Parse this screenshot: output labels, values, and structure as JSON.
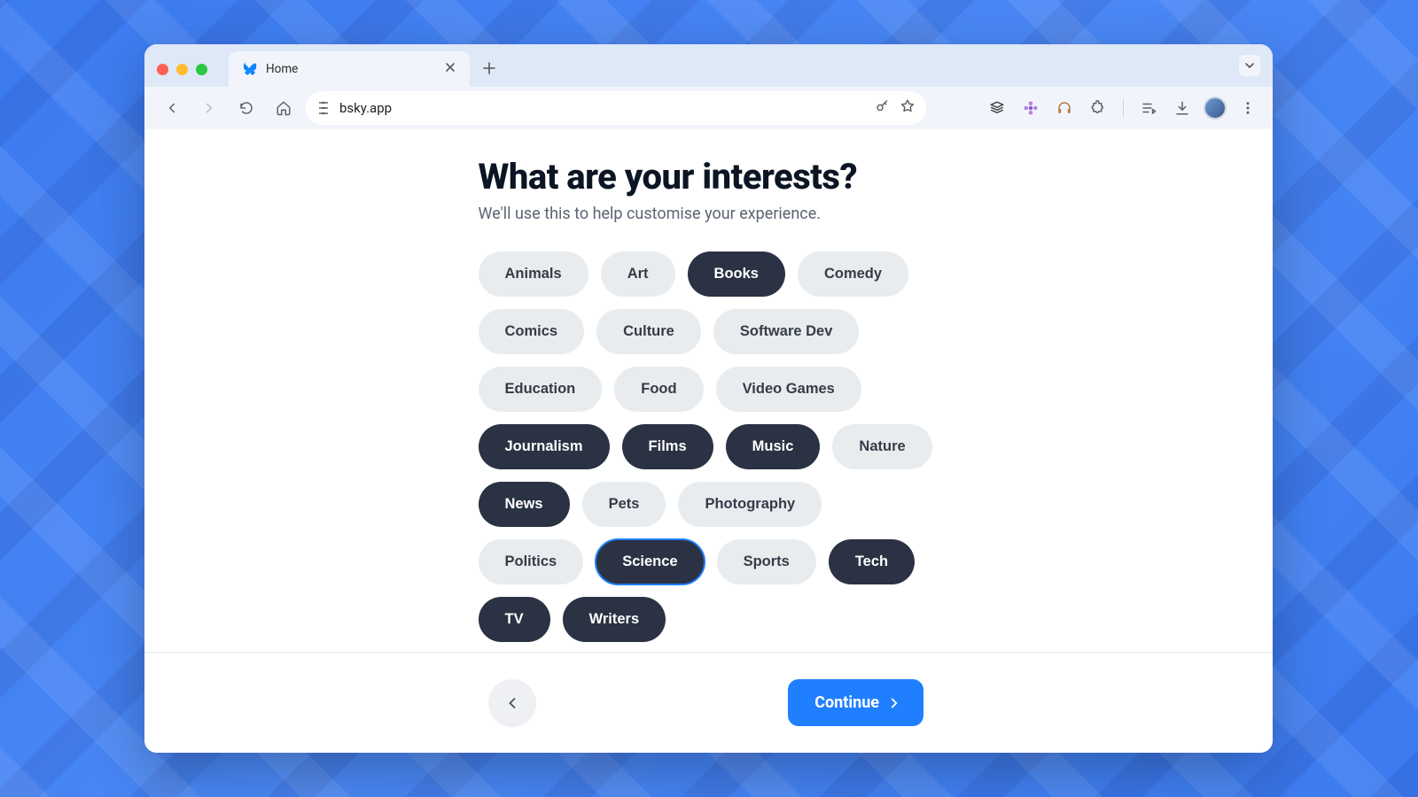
{
  "browser": {
    "tab_title": "Home",
    "address": "bsky.app",
    "colors": {
      "accent": "#1f7fff",
      "chip_selected_bg": "#2a3243"
    }
  },
  "page": {
    "title": "What are your interests?",
    "subtitle": "We'll use this to help customise your experience."
  },
  "interests": [
    {
      "label": "Animals",
      "selected": false
    },
    {
      "label": "Art",
      "selected": false
    },
    {
      "label": "Books",
      "selected": true
    },
    {
      "label": "Comedy",
      "selected": false
    },
    {
      "label": "Comics",
      "selected": false
    },
    {
      "label": "Culture",
      "selected": false
    },
    {
      "label": "Software Dev",
      "selected": false
    },
    {
      "label": "Education",
      "selected": false
    },
    {
      "label": "Food",
      "selected": false
    },
    {
      "label": "Video Games",
      "selected": false
    },
    {
      "label": "Journalism",
      "selected": true
    },
    {
      "label": "Films",
      "selected": true
    },
    {
      "label": "Music",
      "selected": true
    },
    {
      "label": "Nature",
      "selected": false
    },
    {
      "label": "News",
      "selected": true
    },
    {
      "label": "Pets",
      "selected": false
    },
    {
      "label": "Photography",
      "selected": false
    },
    {
      "label": "Politics",
      "selected": false
    },
    {
      "label": "Science",
      "selected": true,
      "focused": true
    },
    {
      "label": "Sports",
      "selected": false
    },
    {
      "label": "Tech",
      "selected": true
    },
    {
      "label": "TV",
      "selected": true
    },
    {
      "label": "Writers",
      "selected": true
    }
  ],
  "footer": {
    "continue_label": "Continue"
  }
}
